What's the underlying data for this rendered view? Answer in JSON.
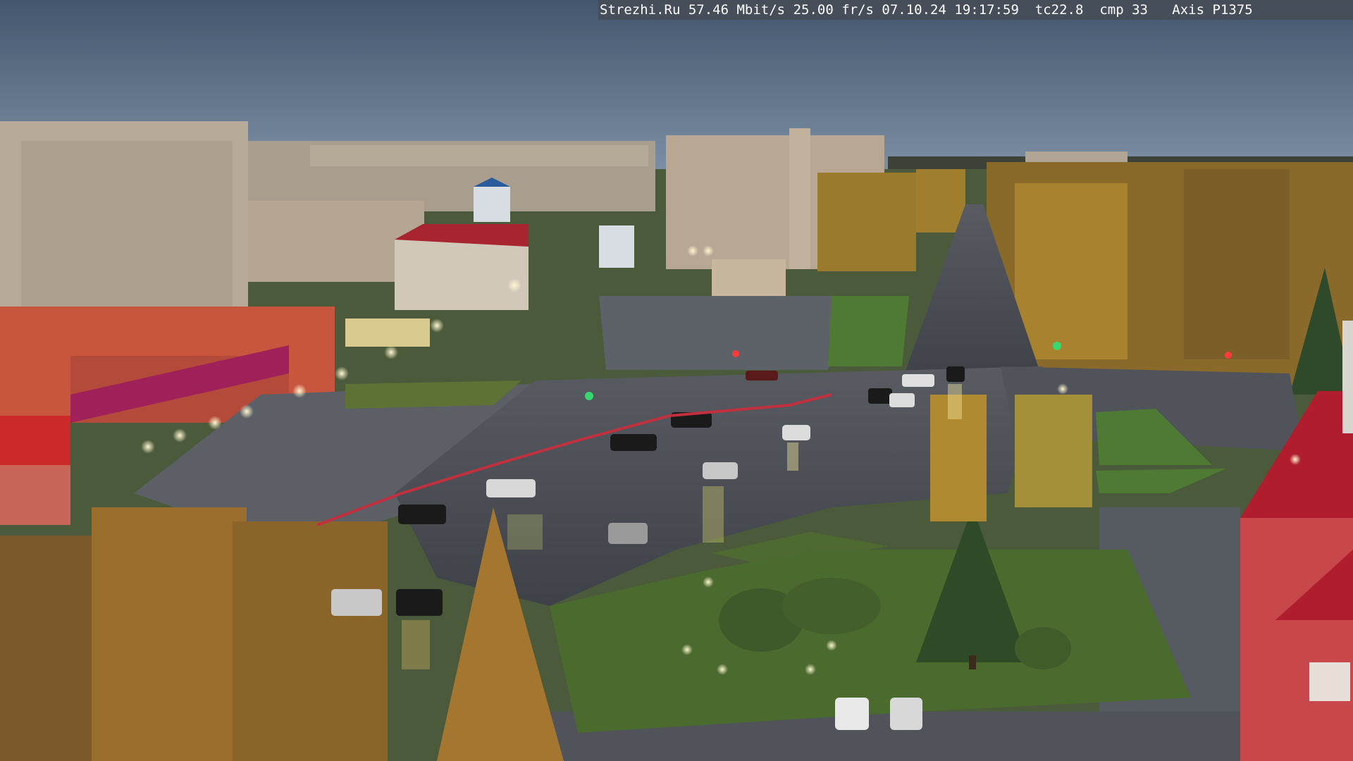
{
  "overlay": {
    "site": "Strezhi.Ru",
    "bitrate": "57.46 Mbit/s",
    "framerate": "25.00 fr/s",
    "date": "07.10.24",
    "time": "19:17:59",
    "tc": "tc22.8",
    "cmp": "cmp 33",
    "camera": "Axis P1375"
  },
  "scene": {
    "sky_color": "#4f6279",
    "road_color": "#4a4e55",
    "grass_color": "#4a6a2e",
    "foliage_color": "#b8862e",
    "building_color": "#b8aa98",
    "store_color": "#c8553e",
    "store_sign_color": "#a0205a",
    "roof_red": "#b01e2e"
  }
}
